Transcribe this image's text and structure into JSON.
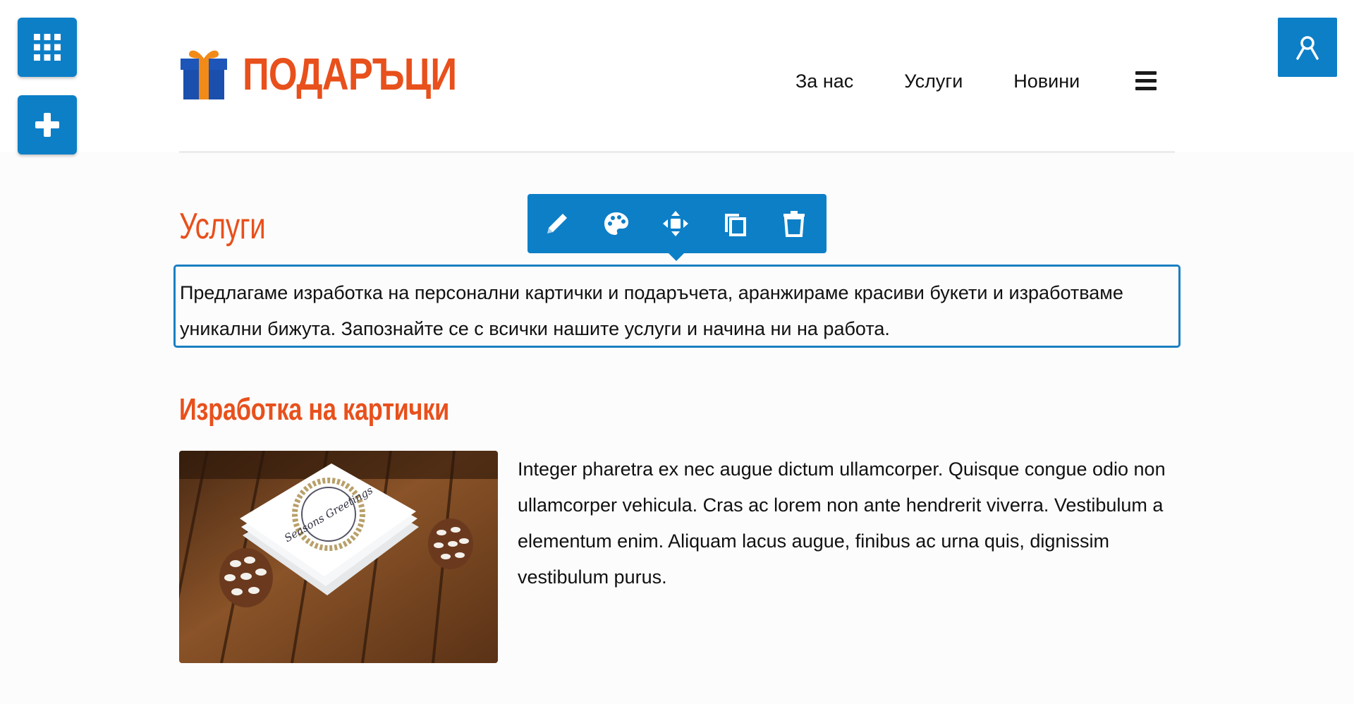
{
  "brand": {
    "name": "ПОДАРЪЦИ"
  },
  "nav": {
    "items": [
      "За нас",
      "Услуги",
      "Новини"
    ]
  },
  "page": {
    "title": "Услуги",
    "intro": "Предлагаме изработка на персонални картички и подаръчета, аранжираме красиви букети и изработваме уникални бижута. Запознайте се с всички нашите услуги и начина ни на работа."
  },
  "section": {
    "title": "Изработка на картички",
    "text": "Integer pharetra ex nec augue dictum ullamcorper. Quisque congue odio non ullamcorper vehicula. Cras ac lorem non ante hendrerit viverra. Vestibulum a elementum enim. Aliquam lacus augue, finibus ac urna quis, dignissim vestibulum purus.",
    "image_text": "Seasons Greetings"
  },
  "toolbar": {
    "icons": [
      "pencil-icon",
      "palette-icon",
      "move-icon",
      "copy-icon",
      "trash-icon"
    ]
  },
  "side_buttons": [
    "apps-grid-icon",
    "plus-icon",
    "user-icon"
  ],
  "colors": {
    "accent": "#e8501c",
    "editor_blue": "#0d7fc7",
    "selection_border": "#1a7fc2"
  }
}
